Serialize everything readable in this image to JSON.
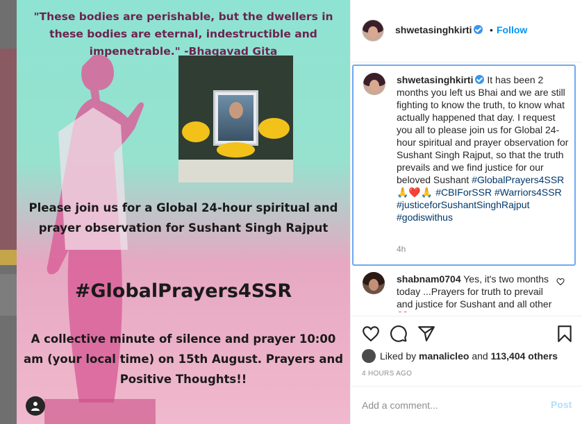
{
  "post": {
    "quote": "\"These bodies are perishable, but the dwellers in these bodies are eternal, indestructible and impenetrable.\" -Bhagavad Gita",
    "invite": "Please join us for a Global 24-hour spiritual and prayer observation for Sushant Singh Rajput",
    "hashtag": "#GlobalPrayers4SSR",
    "details": "A collective minute of silence and prayer 10:00 am (your local time) on 15th August. Prayers and Positive Thoughts!!"
  },
  "header": {
    "username": "shwetasinghkirti",
    "dot": "•",
    "follow_label": "Follow"
  },
  "caption": {
    "username": "shwetasinghkirti",
    "text": "It has been 2 months you left us Bhai and we are still fighting to know the truth, to know what actually happened that day. I request you all to please join us for Global 24-hour spiritual and prayer observation for Sushant Singh Rajput, so that the truth prevails and we find justice for our beloved Sushant",
    "emoji": "🙏❤️🙏",
    "tags": [
      "#GlobalPrayers4SSR",
      "#CBIForSSR",
      "#Warriors4SSR",
      "#justiceforSushantSinghRajput",
      "#godiswithus"
    ],
    "time": "4h"
  },
  "comment": {
    "username": "shabnam0704",
    "text": "Yes, it's two months today ...Prayers for truth to prevail and justice for Sushant and all other",
    "emoji": "❤️"
  },
  "likes": {
    "prefix": "Liked by",
    "user": "manalicleo",
    "and": "and",
    "count": "113,404 others"
  },
  "post_time": "4 HOURS AGO",
  "add_comment": {
    "placeholder": "Add a comment...",
    "post_label": "Post"
  },
  "icons": [
    "like-icon",
    "comment-icon",
    "share-icon",
    "save-icon",
    "tag-people-icon",
    "verified-icon",
    "heart-small-icon"
  ],
  "colors": {
    "accent": "#0095f6",
    "hashtag": "#00376b",
    "verified": "#3897f0",
    "focus_border": "#6fa8f3"
  }
}
